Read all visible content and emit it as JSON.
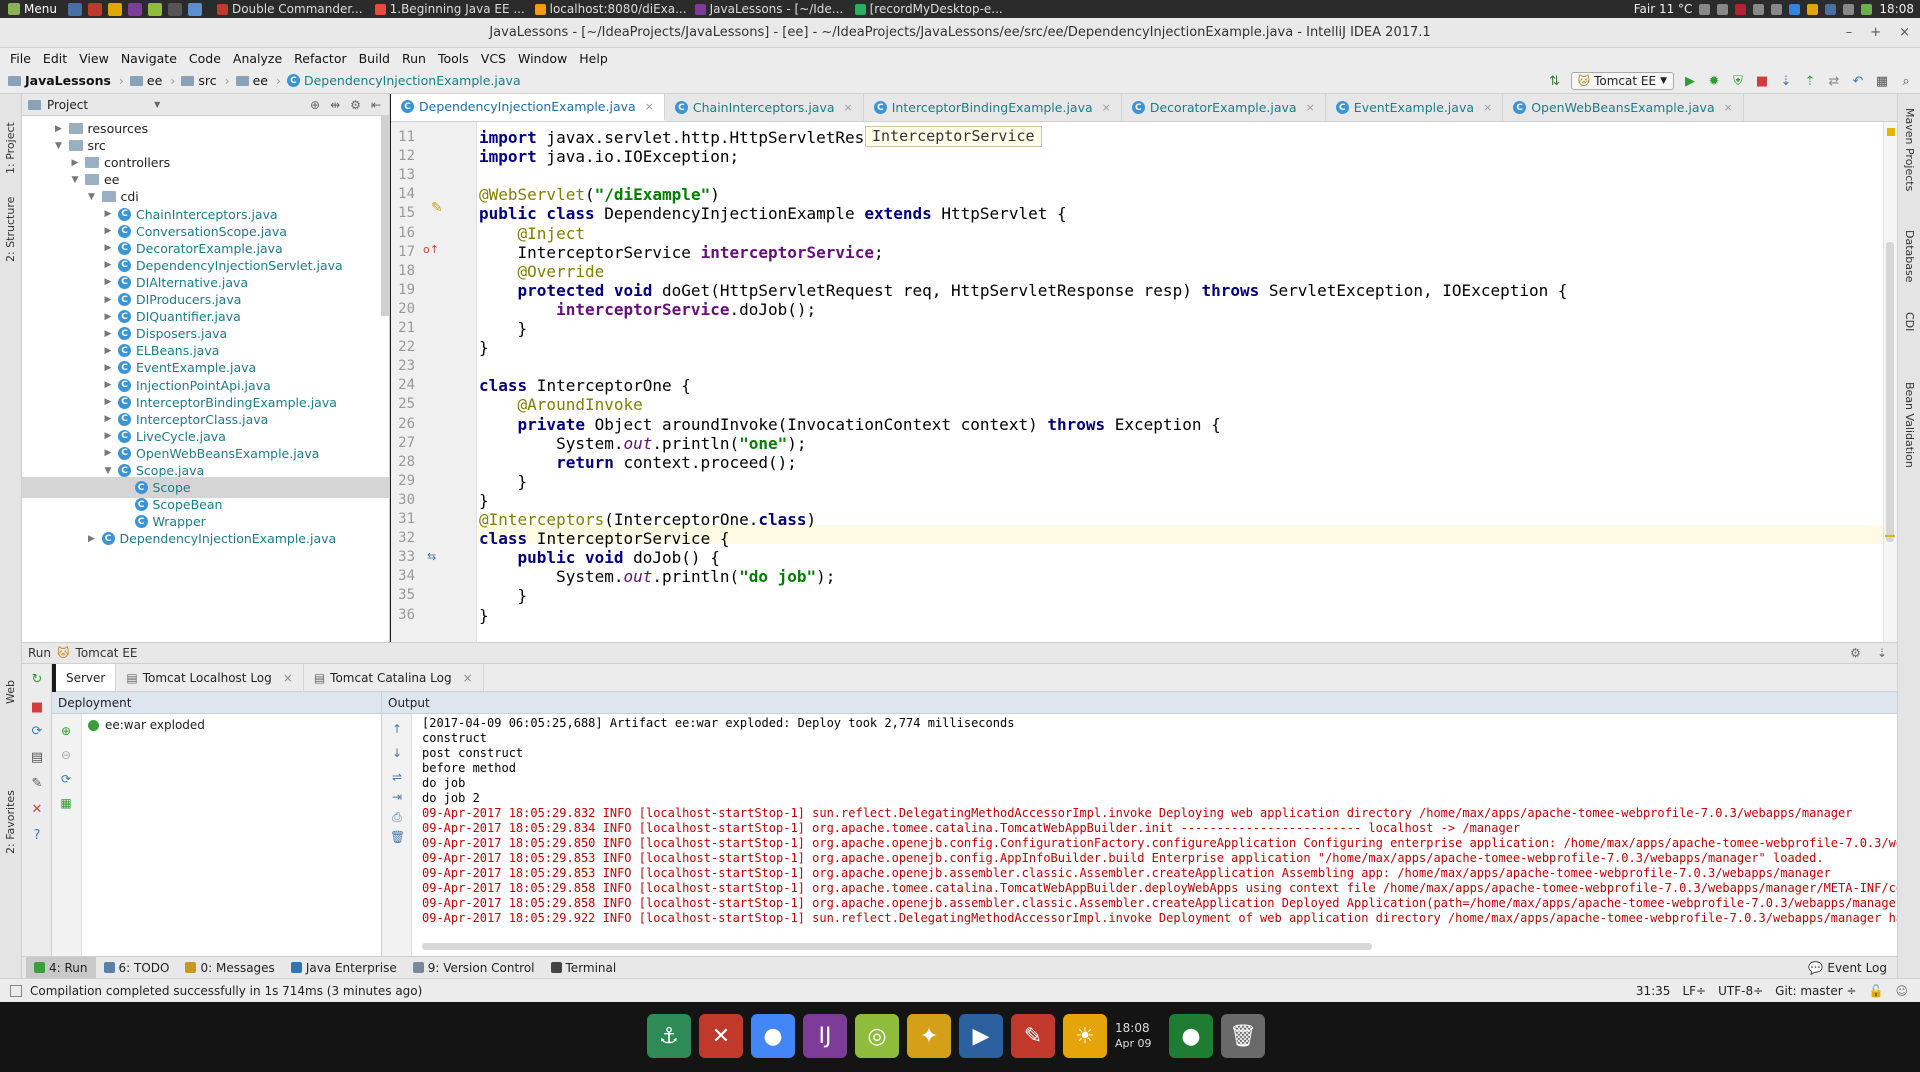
{
  "os_panel": {
    "menu_label": "Menu",
    "tasks": [
      {
        "label": "Double Commander...",
        "color": "#c0392b"
      },
      {
        "label": "1.Beginning Java EE ...",
        "color": "#e74c3c"
      },
      {
        "label": "localhost:8080/diExa...",
        "color": "#f39c12"
      },
      {
        "label": "JavaLessons - [~/Ide...",
        "color": "#7d3c98"
      },
      {
        "label": "[recordMyDesktop-e...",
        "color": "#27ae60"
      }
    ],
    "weather": "Fair 11 °C",
    "clock": "18:08"
  },
  "window": {
    "title": "JavaLessons - [~/IdeaProjects/JavaLessons] - [ee] - ~/IdeaProjects/JavaLessons/ee/src/ee/DependencyInjectionExample.java - IntelliJ IDEA 2017.1"
  },
  "menu": [
    "File",
    "Edit",
    "View",
    "Navigate",
    "Code",
    "Analyze",
    "Refactor",
    "Build",
    "Run",
    "Tools",
    "VCS",
    "Window",
    "Help"
  ],
  "breadcrumbs": [
    "JavaLessons",
    "ee",
    "src",
    "ee",
    "DependencyInjectionExample.java"
  ],
  "run_config": "Tomcat EE",
  "project_panel": {
    "title": "Project",
    "tree": [
      {
        "label": "resources",
        "depth": 1,
        "type": "folder",
        "arrow": "▶"
      },
      {
        "label": "src",
        "depth": 1,
        "type": "folder",
        "arrow": "▼"
      },
      {
        "label": "controllers",
        "depth": 2,
        "type": "folder",
        "arrow": "▶"
      },
      {
        "label": "ee",
        "depth": 2,
        "type": "folder",
        "arrow": "▼"
      },
      {
        "label": "cdi",
        "depth": 3,
        "type": "folder",
        "arrow": "▼"
      },
      {
        "label": "ChainInterceptors.java",
        "depth": 4,
        "type": "java",
        "arrow": "▶"
      },
      {
        "label": "ConversationScope.java",
        "depth": 4,
        "type": "java",
        "arrow": "▶"
      },
      {
        "label": "DecoratorExample.java",
        "depth": 4,
        "type": "java",
        "arrow": "▶"
      },
      {
        "label": "DependencyInjectionServlet.java",
        "depth": 4,
        "type": "java",
        "arrow": "▶"
      },
      {
        "label": "DIAlternative.java",
        "depth": 4,
        "type": "java",
        "arrow": "▶"
      },
      {
        "label": "DIProducers.java",
        "depth": 4,
        "type": "java",
        "arrow": "▶"
      },
      {
        "label": "DIQuantifier.java",
        "depth": 4,
        "type": "java",
        "arrow": "▶"
      },
      {
        "label": "Disposers.java",
        "depth": 4,
        "type": "java",
        "arrow": "▶"
      },
      {
        "label": "ELBeans.java",
        "depth": 4,
        "type": "java",
        "arrow": "▶"
      },
      {
        "label": "EventExample.java",
        "depth": 4,
        "type": "java",
        "arrow": "▶"
      },
      {
        "label": "InjectionPointApi.java",
        "depth": 4,
        "type": "java",
        "arrow": "▶"
      },
      {
        "label": "InterceptorBindingExample.java",
        "depth": 4,
        "type": "java",
        "arrow": "▶"
      },
      {
        "label": "InterceptorClass.java",
        "depth": 4,
        "type": "java",
        "arrow": "▶"
      },
      {
        "label": "LiveCycle.java",
        "depth": 4,
        "type": "java",
        "arrow": "▶"
      },
      {
        "label": "OpenWebBeansExample.java",
        "depth": 4,
        "type": "java",
        "arrow": "▶"
      },
      {
        "label": "Scope.java",
        "depth": 4,
        "type": "java",
        "arrow": "▼"
      },
      {
        "label": "Scope",
        "depth": 5,
        "type": "class",
        "arrow": "",
        "selected": true
      },
      {
        "label": "ScopeBean",
        "depth": 5,
        "type": "class",
        "arrow": ""
      },
      {
        "label": "Wrapper",
        "depth": 5,
        "type": "class",
        "arrow": ""
      },
      {
        "label": "DependencyInjectionExample.java",
        "depth": 3,
        "type": "java",
        "arrow": "▶"
      }
    ]
  },
  "editor_tabs": [
    {
      "label": "DependencyInjectionExample.java",
      "active": true
    },
    {
      "label": "ChainInterceptors.java"
    },
    {
      "label": "InterceptorBindingExample.java"
    },
    {
      "label": "DecoratorExample.java"
    },
    {
      "label": "EventExample.java"
    },
    {
      "label": "OpenWebBeansExample.java"
    }
  ],
  "editor": {
    "popup": "InterceptorService",
    "lines": [
      {
        "n": "11",
        "html": "<span class=\"kw\">import</span> javax.servlet.http.HttpServletResponse;"
      },
      {
        "n": "12",
        "html": "<span class=\"kw\">import</span> java.io.IOException;"
      },
      {
        "n": "13",
        "html": ""
      },
      {
        "n": "14",
        "html": "<span class=\"ann\">@WebServlet</span>(<span class=\"str\">\"/diExample\"</span>)"
      },
      {
        "n": "15",
        "html": "<span class=\"kw\">public class</span> DependencyInjectionExample <span class=\"kw\">extends</span> HttpServlet {"
      },
      {
        "n": "16",
        "html": "    <span class=\"ann\">@Inject</span>"
      },
      {
        "n": "17",
        "html": "    InterceptorService <span class=\"fld\">interceptorService</span>;"
      },
      {
        "n": "18",
        "html": "    <span class=\"ann\">@Override</span>"
      },
      {
        "n": "19",
        "html": "    <span class=\"kw\">protected void</span> doGet(HttpServletRequest req, HttpServletResponse resp) <span class=\"kw\">throws</span> ServletException, IOException {"
      },
      {
        "n": "20",
        "html": "        <span class=\"fld\">interceptorService</span>.doJob();"
      },
      {
        "n": "21",
        "html": "    }"
      },
      {
        "n": "22",
        "html": "}"
      },
      {
        "n": "23",
        "html": ""
      },
      {
        "n": "24",
        "html": "<span class=\"kw\">class</span> InterceptorOne {"
      },
      {
        "n": "25",
        "html": "    <span class=\"ann\">@AroundInvoke</span>"
      },
      {
        "n": "26",
        "html": "    <span class=\"kw\">private</span> Object aroundInvoke(InvocationContext context) <span class=\"kw\">throws</span> Exception {"
      },
      {
        "n": "27",
        "html": "        System.<span class=\"sta\">out</span>.println(<span class=\"str\">\"one\"</span>);"
      },
      {
        "n": "28",
        "html": "        <span class=\"kw\">return</span> context.proceed();"
      },
      {
        "n": "29",
        "html": "    }"
      },
      {
        "n": "30",
        "html": "}"
      },
      {
        "n": "31",
        "html": "<span class=\"ann\">@Interceptors</span>(InterceptorOne.<span class=\"kw\">class</span>)"
      },
      {
        "n": "32",
        "html": "<span class=\"kw\">class</span> InterceptorService {"
      },
      {
        "n": "33",
        "html": "    <span class=\"kw\">public void</span> doJob() {"
      },
      {
        "n": "34",
        "html": "        System.<span class=\"sta\">out</span>.println(<span class=\"str\">\"do job\"</span>);"
      },
      {
        "n": "35",
        "html": "    }"
      },
      {
        "n": "36",
        "html": "}"
      }
    ]
  },
  "run_panel": {
    "title": "Run",
    "config": "Tomcat EE",
    "tabs": [
      {
        "label": "Server",
        "active": true
      },
      {
        "label": "Tomcat Localhost Log"
      },
      {
        "label": "Tomcat Catalina Log"
      }
    ],
    "deployment_header": "Deployment",
    "deployment_item": "ee:war exploded",
    "output_header": "Output",
    "output": [
      {
        "t": "[2017-04-09 06:05:25,688] Artifact ee:war exploded: Deploy took 2,774 milliseconds",
        "c": "o-plain"
      },
      {
        "t": "construct",
        "c": "o-plain"
      },
      {
        "t": "post construct",
        "c": "o-plain"
      },
      {
        "t": "before method",
        "c": "o-plain"
      },
      {
        "t": "do job",
        "c": "o-plain"
      },
      {
        "t": "do job 2",
        "c": "o-plain"
      },
      {
        "t": "09-Apr-2017 18:05:29.832 INFO [localhost-startStop-1] sun.reflect.DelegatingMethodAccessorImpl.invoke Deploying web application directory /home/max/apps/apache-tomee-webprofile-7.0.3/webapps/manager",
        "c": "o-err"
      },
      {
        "t": "09-Apr-2017 18:05:29.834 INFO [localhost-startStop-1] org.apache.tomee.catalina.TomcatWebAppBuilder.init ------------------------- localhost -> /manager",
        "c": "o-err"
      },
      {
        "t": "09-Apr-2017 18:05:29.850 INFO [localhost-startStop-1] org.apache.openejb.config.ConfigurationFactory.configureApplication Configuring enterprise application: /home/max/apps/apache-tomee-webprofile-7.0.3/webapps/",
        "c": "o-err"
      },
      {
        "t": "09-Apr-2017 18:05:29.853 INFO [localhost-startStop-1] org.apache.openejb.config.AppInfoBuilder.build Enterprise application \"/home/max/apps/apache-tomee-webprofile-7.0.3/webapps/manager\" loaded.",
        "c": "o-err"
      },
      {
        "t": "09-Apr-2017 18:05:29.853 INFO [localhost-startStop-1] org.apache.openejb.assembler.classic.Assembler.createApplication Assembling app: /home/max/apps/apache-tomee-webprofile-7.0.3/webapps/manager",
        "c": "o-err"
      },
      {
        "t": "09-Apr-2017 18:05:29.858 INFO [localhost-startStop-1] org.apache.tomee.catalina.TomcatWebAppBuilder.deployWebApps using context file /home/max/apps/apache-tomee-webprofile-7.0.3/webapps/manager/META-INF/context.",
        "c": "o-err"
      },
      {
        "t": "09-Apr-2017 18:05:29.858 INFO [localhost-startStop-1] org.apache.openejb.assembler.classic.Assembler.createApplication Deployed Application(path=/home/max/apps/apache-tomee-webprofile-7.0.3/webapps/manager)",
        "c": "o-err"
      },
      {
        "t": "09-Apr-2017 18:05:29.922 INFO [localhost-startStop-1] sun.reflect.DelegatingMethodAccessorImpl.invoke Deployment of web application directory /home/max/apps/apache-tomee-webprofile-7.0.3/webapps/manager has fini",
        "c": "o-err"
      }
    ]
  },
  "bottom_tabs": [
    {
      "label": "4: Run",
      "active": true,
      "color": "#3c9d3c"
    },
    {
      "label": "6: TODO",
      "color": "#5c7fa6"
    },
    {
      "label": "0: Messages",
      "color": "#c79a1e"
    },
    {
      "label": "Java Enterprise",
      "color": "#2f75b5"
    },
    {
      "label": "9: Version Control",
      "color": "#7a8a9a"
    },
    {
      "label": "Terminal",
      "color": "#444444"
    }
  ],
  "event_log": "Event Log",
  "status": {
    "message": "Compilation completed successfully in 1s 714ms (3 minutes ago)",
    "position": "31:35",
    "line_sep": "LF÷",
    "encoding": "UTF-8÷",
    "git": "Git: master ÷"
  },
  "left_strip": [
    "1: Project",
    "2: Structure",
    "Web",
    "2: Favorites"
  ],
  "right_strip": [
    "Maven Projects",
    "Database",
    "CDI",
    "Bean Validation"
  ],
  "dock": {
    "icons": [
      {
        "name": "anchor-icon",
        "glyph": "⚓",
        "bg": "#2e8b57"
      },
      {
        "name": "double-commander-icon",
        "glyph": "✕",
        "bg": "#c0392b"
      },
      {
        "name": "chrome-icon",
        "glyph": "●",
        "bg": "#4285f4"
      },
      {
        "name": "intellij-icon",
        "glyph": "IJ",
        "bg": "#7d3c98"
      },
      {
        "name": "spiral-icon",
        "glyph": "◎",
        "bg": "#8fbc3b"
      },
      {
        "name": "puzzle-icon",
        "glyph": "✦",
        "bg": "#d4a017"
      },
      {
        "name": "player-icon",
        "glyph": "▶",
        "bg": "#2c5f9e"
      },
      {
        "name": "pdf-icon",
        "glyph": "✎",
        "bg": "#c0392b"
      },
      {
        "name": "weather-icon",
        "glyph": "☀",
        "bg": "#e5a50a"
      },
      {
        "name": "record-icon",
        "glyph": "●",
        "bg": "#1e7d32"
      }
    ],
    "time": "18:08",
    "date": "Apr 09"
  }
}
